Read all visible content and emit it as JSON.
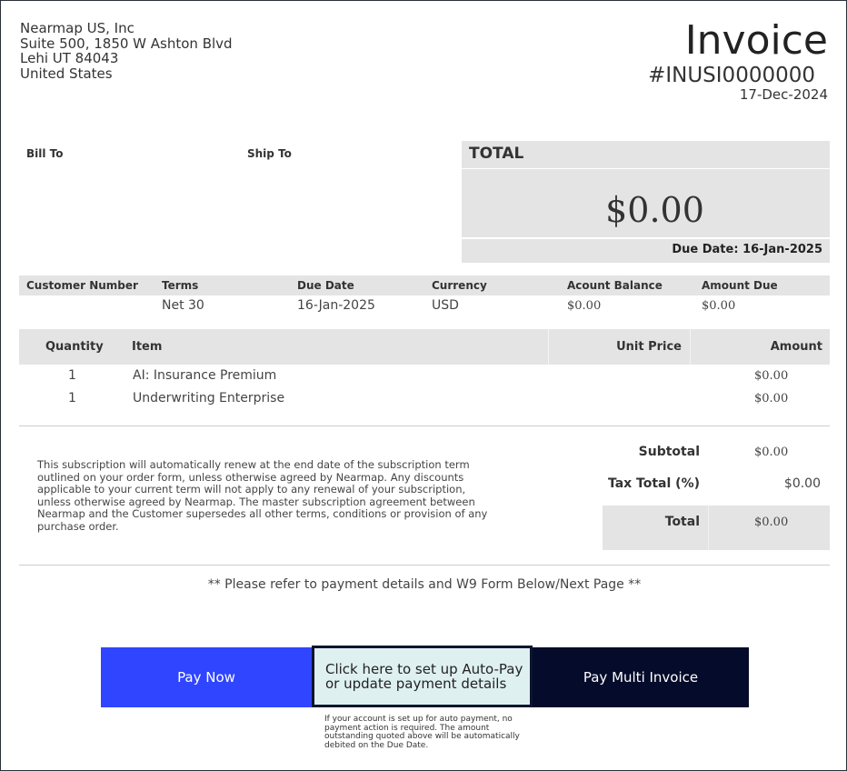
{
  "from": {
    "company": "Nearmap US, Inc",
    "address1": "Suite 500, 1850 W Ashton Blvd",
    "address2": "Lehi UT 84043",
    "country": "United States"
  },
  "invoice": {
    "title": "Invoice",
    "number": "#INUSI0000000",
    "date": "17-Dec-2024"
  },
  "parties": {
    "bill_to": "Bill To",
    "ship_to": "Ship To"
  },
  "total_box": {
    "label": "TOTAL",
    "amount": "$0.00",
    "due": "Due Date: 16-Jan-2025"
  },
  "meta": {
    "headers": [
      "Customer Number",
      "Terms",
      "Due Date",
      "Currency",
      "Acount Balance",
      "Amount Due"
    ],
    "values": [
      "",
      "Net 30",
      "16-Jan-2025",
      "USD",
      "$0.00",
      "$0.00"
    ]
  },
  "items": {
    "headers": [
      "Quantity",
      "Item",
      "Unit Price",
      "Amount"
    ],
    "rows": [
      {
        "qty": "1",
        "item": "AI: Insurance Premium",
        "unit_price": "",
        "amount": "$0.00"
      },
      {
        "qty": "1",
        "item": "Underwriting Enterprise",
        "unit_price": "",
        "amount": "$0.00"
      }
    ]
  },
  "terms_text": "This subscription will automatically renew at the end date of the subscription term outlined on your order form, unless otherwise agreed by Nearmap. Any discounts applicable to your current term will not apply to any renewal of your subscription, unless otherwise agreed by Nearmap. The master subscription agreement between Nearmap and the Customer supersedes all other terms, conditions or provision of any purchase order.",
  "summary": {
    "subtotal_label": "Subtotal",
    "subtotal_value": "$0.00",
    "tax_label": "Tax Total (%)",
    "tax_value": "$0.00",
    "total_label": "Total",
    "total_value": "$0.00"
  },
  "refer_text": "** Please refer to payment details and W9 Form Below/Next Page **",
  "actions": {
    "pay_now": "Pay Now",
    "auto_pay": "Click here to set up Auto-Pay or update payment details",
    "pay_multi": "Pay Multi Invoice",
    "auto_note": "If your account is set up for auto payment, no payment action is required. The amount outstanding quoted above will be automatically debited on the Due Date."
  },
  "colors": {
    "pay_now_bg": "#2f45ff",
    "auto_pay_bg": "#dff0f0",
    "pay_multi_bg": "#050b2a",
    "header_band": "#e4e4e4"
  }
}
